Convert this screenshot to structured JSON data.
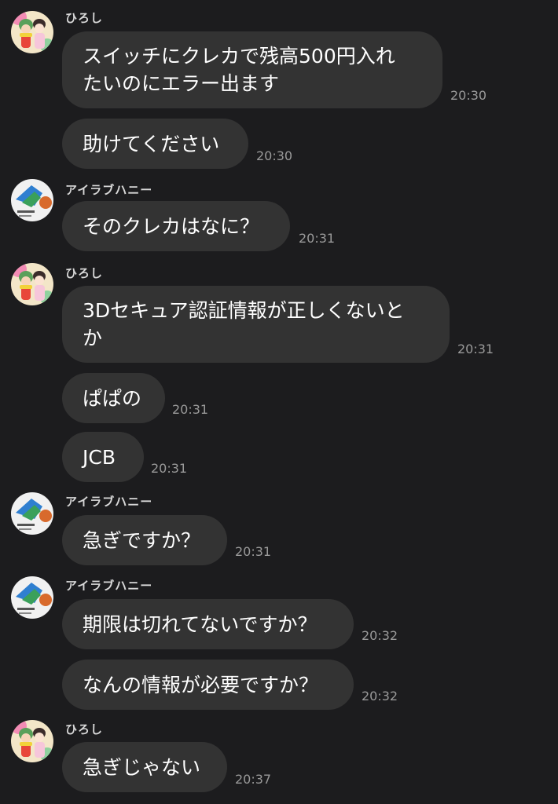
{
  "users": {
    "hiroshi": {
      "name": "ひろし",
      "avatar_icon": "anime-characters-avatar-icon"
    },
    "ailove": {
      "name": "アイラブハニー",
      "avatar_icon": "illustration-avatar-icon"
    }
  },
  "messages": [
    {
      "text": "スイッチにクレカで残高500円入れ\nたいのにエラー出ます",
      "time": "20:30"
    },
    {
      "text": "助けてください",
      "time": "20:30"
    },
    {
      "text": "そのクレカはなに？",
      "time": "20:31"
    },
    {
      "text": "3Dセキュア認証情報が正しくないと\nか",
      "time": "20:31"
    },
    {
      "text": "ぱぱの",
      "time": "20:31"
    },
    {
      "text": "JCB",
      "time": "20:31"
    },
    {
      "text": "急ぎですか？",
      "time": "20:31"
    },
    {
      "text": "期限は切れてないですか？",
      "time": "20:32"
    },
    {
      "text": "なんの情報が必要ですか？",
      "time": "20:32"
    },
    {
      "text": "急ぎじゃない",
      "time": "20:37"
    }
  ]
}
